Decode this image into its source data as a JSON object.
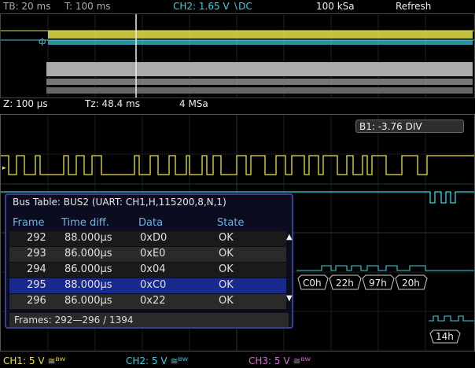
{
  "topbar": {
    "timebase": "TB: 20 ms",
    "trigger_time": "T: 100 ms",
    "trigger_channel": "CH2: 1.65 V ∖DC",
    "sample_rate": "100 kSa",
    "acq_mode": "Refresh"
  },
  "zoombar": {
    "zoom_scale": "Z: 100 µs",
    "zoom_position": "Tz: 48.4 ms",
    "zoom_rate": "4 MSa"
  },
  "zoom": {
    "b1_label": "B1: -3.76 DIV"
  },
  "bus_table": {
    "title": "Bus Table: BUS2 (UART: CH1,H,115200,8,N,1)",
    "headers": [
      "Frame",
      "Time diff.",
      "Data",
      "State"
    ],
    "rows": [
      {
        "frame": "292",
        "time": "88.000µs",
        "data": "0xD0",
        "state": "OK"
      },
      {
        "frame": "293",
        "time": "86.000µs",
        "data": "0xE0",
        "state": "OK"
      },
      {
        "frame": "294",
        "time": "86.000µs",
        "data": "0x04",
        "state": "OK"
      },
      {
        "frame": "295",
        "time": "88.000µs",
        "data": "0xC0",
        "state": "OK"
      },
      {
        "frame": "296",
        "time": "86.000µs",
        "data": "0x22",
        "state": "OK"
      }
    ],
    "selected_index": 3,
    "footer": "Frames: 292—296 / 1394"
  },
  "decode_labels": [
    "C0h",
    "22h",
    "97h",
    "20h",
    "14h"
  ],
  "statusbar": {
    "ch1": "CH1: 5 V ≅ᴮᵂ",
    "ch2": "CH2: 5 V ≅ᴮᵂ",
    "ch3": "CH3: 5 V ≅ᴮᵂ"
  },
  "colors": {
    "ch1": "#e8e04a",
    "ch2": "#3fd0e0",
    "ch3": "#d070d0",
    "selection": "#1a2a8c"
  }
}
